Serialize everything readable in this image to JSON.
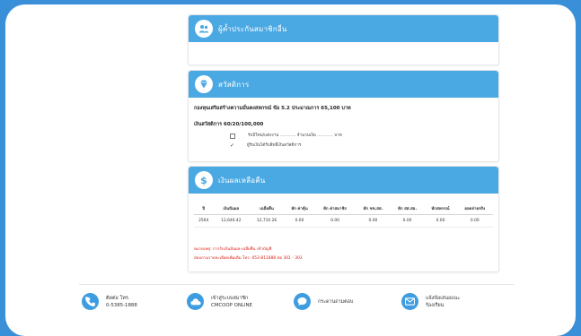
{
  "sections": {
    "guarantor": {
      "title": "ผู้ค้ำประกันสมาชิกอื่น",
      "icon": "users-icon"
    },
    "welfare": {
      "title": "สวัสดิการ",
      "icon": "diamond-icon",
      "line1": "กองทุนเสริมสร้างความมั่นคงสหกรณ์ ข้อ 5.2 ประมาณการ 65,100 บาท",
      "line2": "เงินสวัสดิการ 60/20/100,000",
      "check1": "รับปีใหม่/แต่งงาน ............ จำนวนเงิน ............ บาท",
      "check2": "ผู้รับเงินได้รับสิทธิ์เงินสวัสดิการ"
    },
    "repayment": {
      "title": "เงินผลเหลือคืน",
      "icon": "dollar-icon",
      "columns": [
        "ปี",
        "เงินปันผล",
        "เฉลี่ยคืน",
        "หัก ค่าหุ้น",
        "หัก ค่าสมาชิก",
        "หัก ชช.สส.",
        "หัก สส.สอ.",
        "หักสหกรณ์",
        "ยอดจ่ายจริง"
      ],
      "row": [
        "2564",
        "12,646.42",
        "12,710.26",
        "0.00",
        "0.00",
        "0.00",
        "0.00",
        "0.00",
        "0.00"
      ],
      "note1": "หมายเหตุ: การรับเงินปันผล-เฉลี่ยคืน เข้าบัญชี",
      "note2": "สอบถามรายละเอียดเพิ่มเติม โทร. 053-811888 ต่อ 301 - 303"
    }
  },
  "footer": {
    "items": [
      {
        "icon": "phone-icon",
        "line1": "ติดต่อ โทร.",
        "line2": "0-5385-1888"
      },
      {
        "icon": "cloud-icon",
        "line1": "เข้าสู่ระบบสมาชิก",
        "line2": "CMCOOP ONLINE"
      },
      {
        "icon": "chat-icon",
        "line1": "กระดานถามตอบ",
        "line2": ""
      },
      {
        "icon": "mail-icon",
        "line1": "แจ้งข้อเสนอแนะ",
        "line2": "ร้องเรียน"
      }
    ]
  },
  "colors": {
    "accent": "#4aa8e2",
    "background": "#3a8fd9",
    "warning_text": "#d9261c"
  }
}
